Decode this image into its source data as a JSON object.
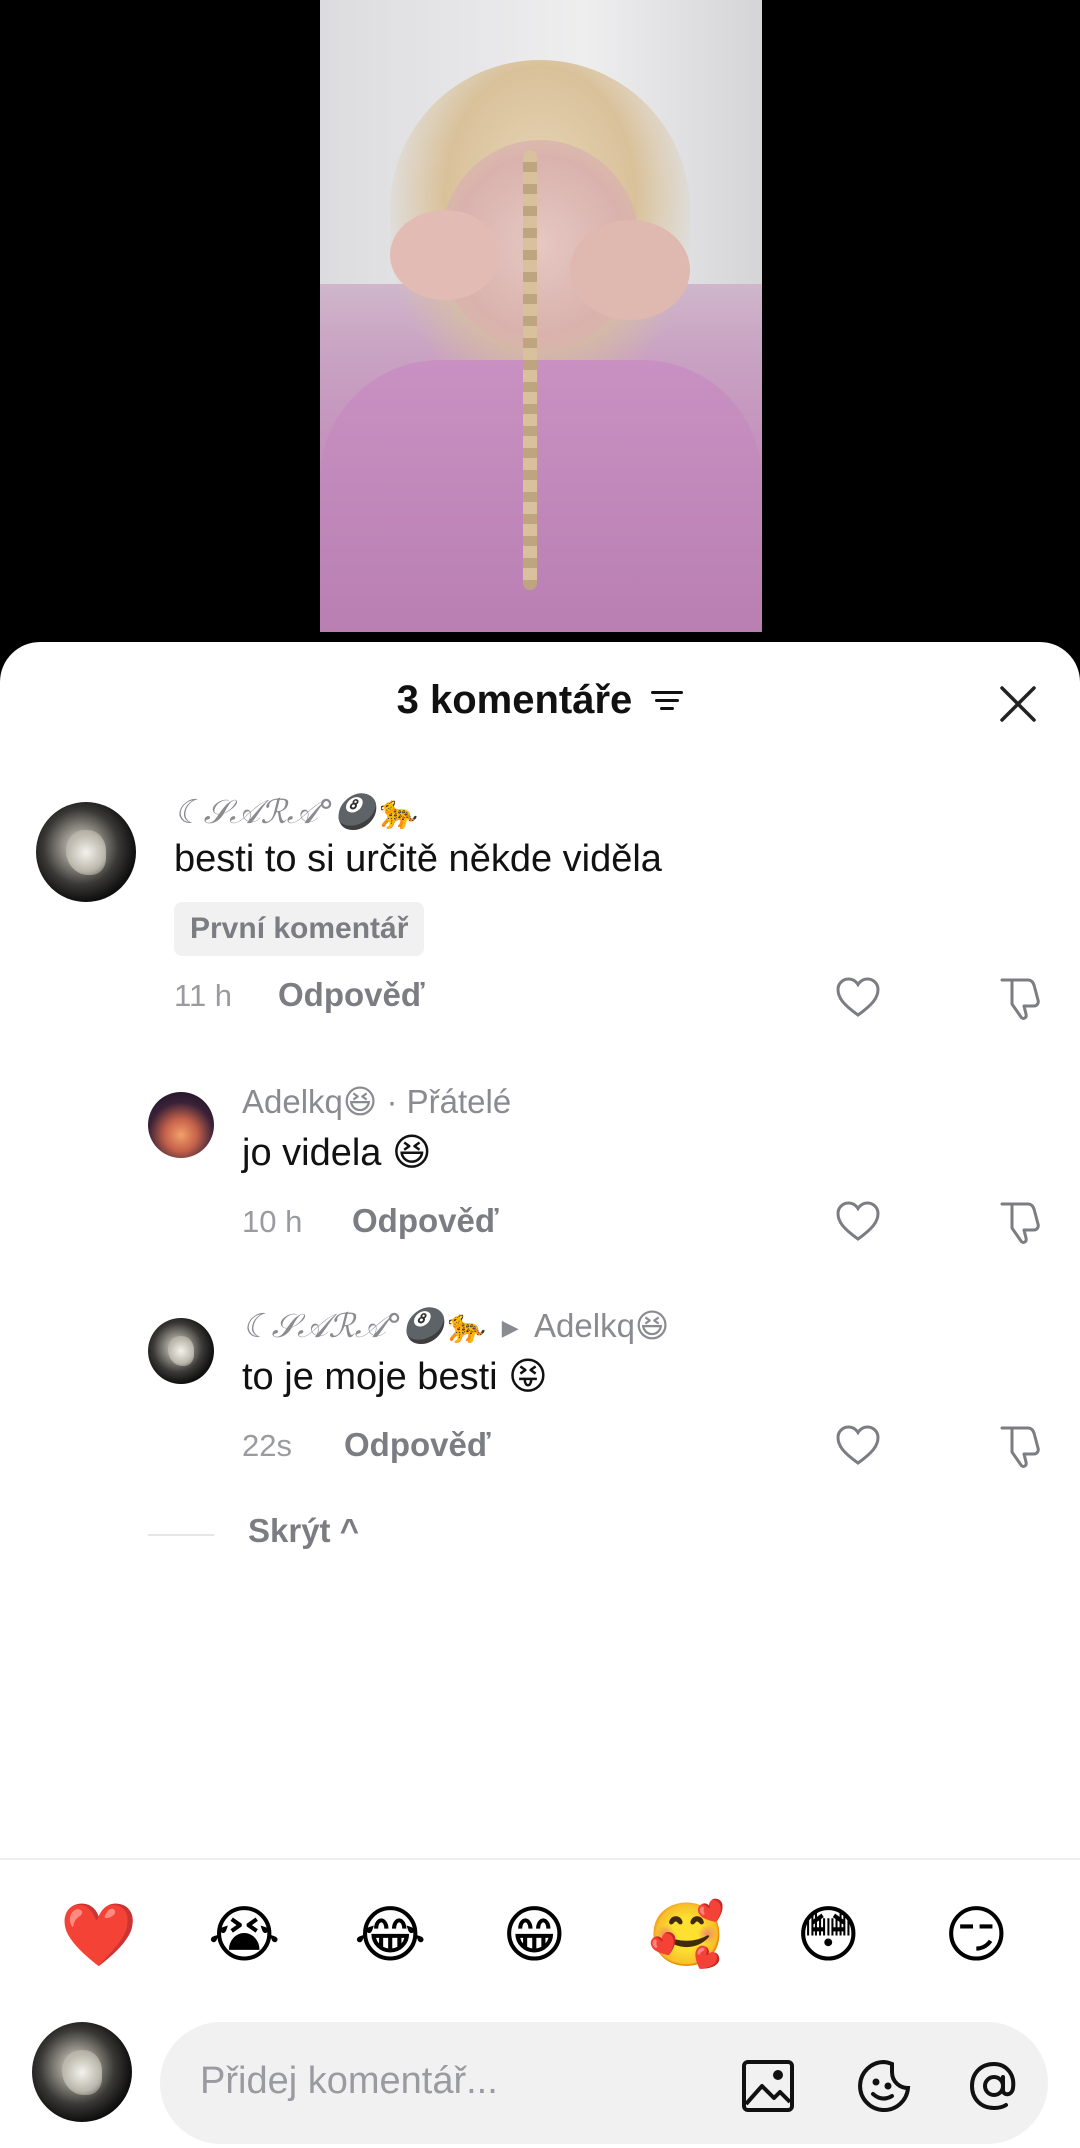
{
  "sheet": {
    "title": "3 komentáře",
    "filter_icon": "filter-lines-icon",
    "close_icon": "close-icon"
  },
  "comments": [
    {
      "username": "☾𝒮𝒜ℛ𝒜°🎱🐆",
      "text": "besti to si určitě někde viděla",
      "badge": "První komentář",
      "time": "11 h",
      "reply_label": "Odpověď"
    },
    {
      "username": "Adelkq😆",
      "friends_label": "· Přátelé",
      "text": "jo videla 😆",
      "time": "10 h",
      "reply_label": "Odpověď"
    },
    {
      "username": "☾𝒮𝒜ℛ𝒜°🎱🐆",
      "reply_to": "Adelkq😆",
      "text": "to je moje besti 😝",
      "time": "22s",
      "reply_label": "Odpověď"
    }
  ],
  "hide_label": "Skrýt ^",
  "emoji_bar": [
    "❤️",
    "😭",
    "😂",
    "😁",
    "🥰",
    "😳",
    "😏"
  ],
  "input": {
    "placeholder": "Přidej komentář...",
    "icons": [
      "image-icon",
      "sticker-icon",
      "mention-icon"
    ]
  },
  "colors": {
    "muted": "#8a8b91",
    "text": "#111111",
    "sheet_bg": "#ffffff",
    "input_bg": "#f1f1f2"
  }
}
